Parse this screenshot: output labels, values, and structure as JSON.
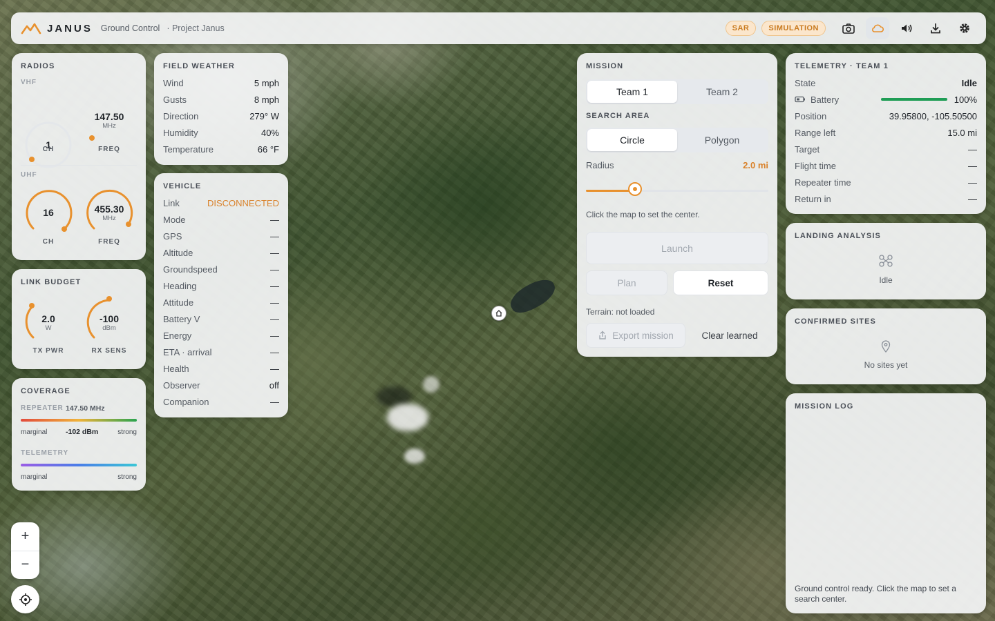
{
  "header": {
    "brand": "JANUS",
    "subtitle": "Ground Control",
    "project": "· Project Janus",
    "pill_sar": "SAR",
    "pill_sim": "SIMULATION"
  },
  "radios": {
    "title": "RADIOS",
    "vhf_label": "VHF",
    "vhf_ch": "1",
    "vhf_freq": "147.50",
    "vhf_freq_unit": "MHz",
    "uhf_label": "UHF",
    "uhf_ch": "16",
    "uhf_freq": "455.30",
    "uhf_freq_unit": "MHz",
    "ch_label": "CH",
    "freq_label": "FREQ"
  },
  "link_budget": {
    "title": "LINK BUDGET",
    "tx_value": "2.0",
    "tx_unit": "W",
    "tx_label": "TX PWR",
    "rx_value": "-100",
    "rx_unit": "dBm",
    "rx_label": "RX SENS"
  },
  "coverage": {
    "title": "COVERAGE",
    "repeater_label": "REPEATER",
    "repeater_freq": "147.50 MHz",
    "marginal": "marginal",
    "strong": "strong",
    "repeater_value": "-102 dBm",
    "telemetry_label": "TELEMETRY"
  },
  "weather": {
    "title": "FIELD WEATHER",
    "rows": [
      {
        "k": "Wind",
        "v": "5 mph"
      },
      {
        "k": "Gusts",
        "v": "8 mph"
      },
      {
        "k": "Direction",
        "v": "279° W"
      },
      {
        "k": "Humidity",
        "v": "40%"
      },
      {
        "k": "Temperature",
        "v": "66 °F"
      }
    ]
  },
  "vehicle": {
    "title": "VEHICLE",
    "link_label": "Link",
    "link_value": "DISCONNECTED",
    "rows": [
      {
        "k": "Mode",
        "v": "—"
      },
      {
        "k": "GPS",
        "v": "—"
      },
      {
        "k": "Altitude",
        "v": "—"
      },
      {
        "k": "Groundspeed",
        "v": "—"
      },
      {
        "k": "Heading",
        "v": "—"
      },
      {
        "k": "Attitude",
        "v": "—"
      },
      {
        "k": "Battery V",
        "v": "—"
      },
      {
        "k": "Energy",
        "v": "—"
      },
      {
        "k": "ETA · arrival",
        "v": "—"
      },
      {
        "k": "Health",
        "v": "—"
      },
      {
        "k": "Observer",
        "v": "off"
      },
      {
        "k": "Companion",
        "v": "—"
      }
    ]
  },
  "mission": {
    "title": "MISSION",
    "team1": "Team 1",
    "team2": "Team 2",
    "search_area": "SEARCH AREA",
    "circle": "Circle",
    "polygon": "Polygon",
    "radius_label": "Radius",
    "radius_value": "2.0 mi",
    "radius_fraction": 0.27,
    "hint": "Click the map to set the center.",
    "launch": "Launch",
    "plan": "Plan",
    "reset": "Reset",
    "terrain": "Terrain: not loaded",
    "export": "Export mission",
    "clear": "Clear learned"
  },
  "telemetry": {
    "title": "TELEMETRY · TEAM 1",
    "state_label": "State",
    "state_value": "Idle",
    "battery_label": "Battery",
    "battery_value": "100%",
    "battery_fraction": 1.0,
    "rows": [
      {
        "k": "Position",
        "v": "39.95800, -105.50500"
      },
      {
        "k": "Range left",
        "v": "15.0 mi"
      },
      {
        "k": "Target",
        "v": "—"
      },
      {
        "k": "Flight time",
        "v": "—"
      },
      {
        "k": "Repeater time",
        "v": "—"
      },
      {
        "k": "Return in",
        "v": "—"
      }
    ]
  },
  "landing": {
    "title": "LANDING ANALYSIS",
    "status": "Idle"
  },
  "confirmed": {
    "title": "CONFIRMED SITES",
    "empty": "No sites yet"
  },
  "log": {
    "title": "MISSION LOG",
    "message": "Ground control ready. Click the map to set a search center."
  },
  "map_controls": {
    "zoom_in": "+",
    "zoom_out": "−"
  },
  "colors": {
    "accent": "#e8912e",
    "green": "#1f9d55",
    "link_disconnected": "#d9822b"
  }
}
